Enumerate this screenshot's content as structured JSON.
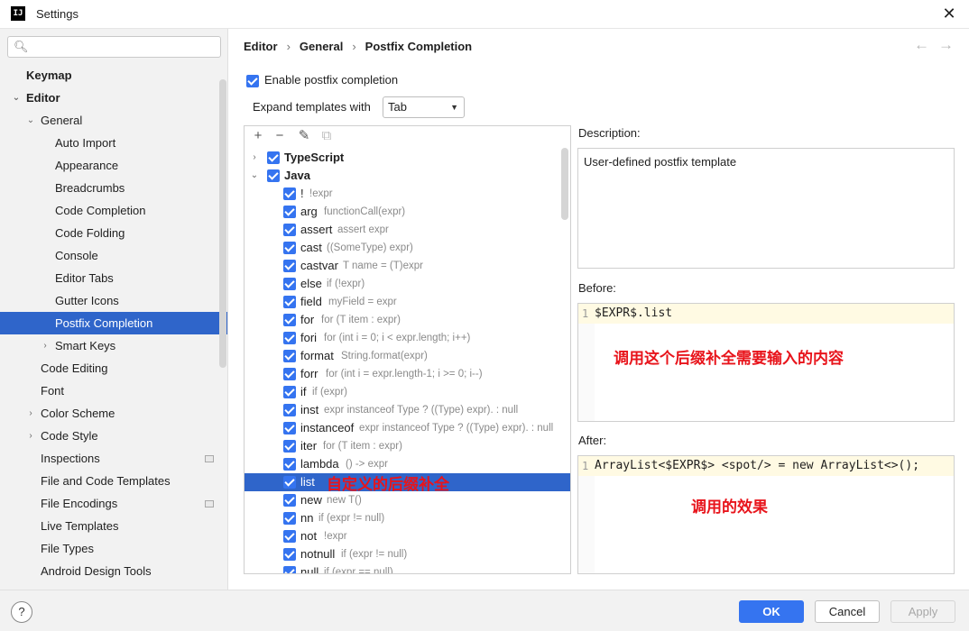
{
  "window": {
    "title": "Settings",
    "app_icon": "IJ"
  },
  "search": {
    "placeholder": ""
  },
  "sidebar": {
    "items": [
      {
        "label": "Keymap"
      },
      {
        "label": "Editor"
      },
      {
        "label": "General"
      },
      {
        "label": "Auto Import"
      },
      {
        "label": "Appearance"
      },
      {
        "label": "Breadcrumbs"
      },
      {
        "label": "Code Completion"
      },
      {
        "label": "Code Folding"
      },
      {
        "label": "Console"
      },
      {
        "label": "Editor Tabs"
      },
      {
        "label": "Gutter Icons"
      },
      {
        "label": "Postfix Completion"
      },
      {
        "label": "Smart Keys"
      },
      {
        "label": "Code Editing"
      },
      {
        "label": "Font"
      },
      {
        "label": "Color Scheme"
      },
      {
        "label": "Code Style"
      },
      {
        "label": "Inspections"
      },
      {
        "label": "File and Code Templates"
      },
      {
        "label": "File Encodings"
      },
      {
        "label": "Live Templates"
      },
      {
        "label": "File Types"
      },
      {
        "label": "Android Design Tools"
      }
    ]
  },
  "breadcrumb": [
    "Editor",
    "General",
    "Postfix Completion"
  ],
  "enable_postfix": {
    "label": "Enable postfix completion",
    "checked": true
  },
  "expand": {
    "label": "Expand templates with",
    "value": "Tab"
  },
  "templates": {
    "groups": [
      {
        "name": "TypeScript",
        "expanded": false
      },
      {
        "name": "Java",
        "expanded": true
      }
    ],
    "items": [
      {
        "key": "!",
        "example": "!expr"
      },
      {
        "key": "arg",
        "example": "functionCall(expr)"
      },
      {
        "key": "assert",
        "example": "assert expr"
      },
      {
        "key": "cast",
        "example": "((SomeType) expr)"
      },
      {
        "key": "castvar",
        "example": "T name = (T)expr"
      },
      {
        "key": "else",
        "example": "if (!expr)"
      },
      {
        "key": "field",
        "example": "myField = expr"
      },
      {
        "key": "for",
        "example": "for (T item : expr)"
      },
      {
        "key": "fori",
        "example": "for (int i = 0; i < expr.length; i++)"
      },
      {
        "key": "format",
        "example": "String.format(expr)"
      },
      {
        "key": "forr",
        "example": "for (int i = expr.length-1; i >= 0; i--)"
      },
      {
        "key": "if",
        "example": "if (expr)"
      },
      {
        "key": "inst",
        "example": "expr instanceof Type ? ((Type) expr). : null"
      },
      {
        "key": "instanceof",
        "example": "expr instanceof Type ? ((Type) expr). : null"
      },
      {
        "key": "iter",
        "example": "for (T item : expr)"
      },
      {
        "key": "lambda",
        "example": "() -> expr"
      },
      {
        "key": "list",
        "example": ""
      },
      {
        "key": "new",
        "example": "new T()"
      },
      {
        "key": "nn",
        "example": "if (expr != null)"
      },
      {
        "key": "not",
        "example": "!expr"
      },
      {
        "key": "notnull",
        "example": "if (expr != null)"
      },
      {
        "key": "null",
        "example": "if (expr == null)"
      }
    ],
    "selected": "list",
    "annotation": "自定义的后缀补全"
  },
  "description": {
    "label": "Description:",
    "text": "User-defined postfix template"
  },
  "before": {
    "label": "Before:",
    "line_no": "1",
    "code": "$EXPR$.list",
    "annotation": "调用这个后缀补全需要输入的内容"
  },
  "after": {
    "label": "After:",
    "line_no": "1",
    "code": "ArrayList<$EXPR$> <spot/> = new ArrayList<>();",
    "annotation": "调用的效果"
  },
  "footer": {
    "help": "?",
    "ok": "OK",
    "cancel": "Cancel",
    "apply": "Apply"
  },
  "colors": {
    "accent": "#3574f0",
    "selection": "#2f65ca",
    "annotation": "#e8141b"
  }
}
